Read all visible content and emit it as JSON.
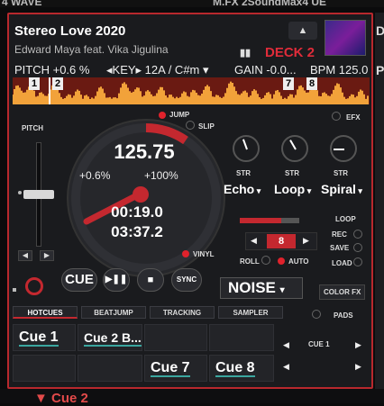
{
  "top_strip": {
    "left_text": "4 WAVE",
    "right_text": "M.FX 2SoundMax4 UE"
  },
  "deck": {
    "title": "Stereo Love 2020",
    "artist": "Edward Maya feat. Vika Jigulina",
    "deck_name": "DECK 2",
    "info": {
      "pitch": "PITCH +0.6 %",
      "key": "◂KEY▸ 12A / C#m ▾",
      "gain": "GAIN -0.0...",
      "bpm": "BPM 125.0"
    },
    "markers": [
      "1",
      "2",
      "7",
      "8"
    ],
    "pitch_label": "PITCH",
    "jump_label": "JUMP",
    "slip_label": "SLIP",
    "platter": {
      "bpm": "125.75",
      "pitch_pct": "+0.6%",
      "range": "+100%",
      "elapsed": "00:19.0",
      "remain": "03:37.2"
    },
    "vinyl_label": "VINYL",
    "efx_label": "EFX",
    "fx": [
      {
        "knob_label": "STR",
        "effect": "Echo",
        "level": 0.2
      },
      {
        "knob_label": "STR",
        "effect": "Loop",
        "level": 0.4
      },
      {
        "knob_label": "STR",
        "effect": "Spiral",
        "level": 0.3
      }
    ],
    "loop": {
      "label": "LOOP",
      "value": "8",
      "rec": "REC",
      "save": "SAVE",
      "load": "LOAD",
      "roll": "ROLL",
      "auto": "AUTO",
      "progress": 0.7
    },
    "transport": {
      "cue": "CUE",
      "play_pause": "▶❚❚",
      "stop": "■",
      "sync": "SYNC"
    },
    "noise": {
      "label": "NOISE",
      "dropdown": "▾",
      "colorfx": "COLOR FX"
    },
    "tabs": [
      "HOTCUES",
      "BEATJUMP",
      "TRACKING",
      "SAMPLER"
    ],
    "pads_label": "PADS",
    "hotcues": [
      "Cue 1",
      "Cue 2 B...",
      "",
      "",
      "",
      "",
      "Cue 7",
      "Cue 8"
    ],
    "cue_nav": "CUE 1",
    "colors": {
      "accent": "#c4282f",
      "deck_red": "#e02c3a",
      "bg": "#1a1b1e"
    }
  },
  "bottom_strip": {
    "cue2": "▼ Cue 2"
  },
  "right_edge_letters": [
    "D",
    "P",
    "´"
  ]
}
